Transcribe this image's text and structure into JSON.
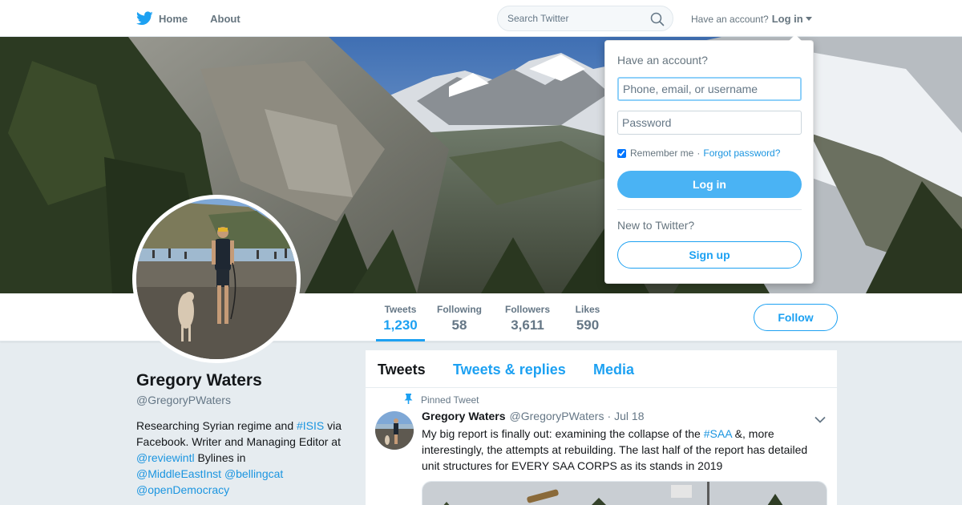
{
  "nav": {
    "home_label": "Home",
    "about_label": "About",
    "search_placeholder": "Search Twitter",
    "have_account": "Have an account?",
    "login_label": "Log in"
  },
  "profile": {
    "name": "Gregory Waters",
    "handle": "@GregoryPWaters",
    "bio_1": "Researching Syrian regime and ",
    "bio_tag_isis": "#ISIS",
    "bio_2": " via Facebook. Writer and Managing Editor at ",
    "bio_mention_reviewintl": "@reviewintl",
    "bio_3": " Bylines in ",
    "bio_mention_mei": "@MiddleEastInst",
    "bio_mention_bellingcat": "@bellingcat",
    "bio_mention_od": "@openDemocracy"
  },
  "stats": [
    {
      "label": "Tweets",
      "value": "1,230"
    },
    {
      "label": "Following",
      "value": "58"
    },
    {
      "label": "Followers",
      "value": "3,611"
    },
    {
      "label": "Likes",
      "value": "590"
    }
  ],
  "follow_label": "Follow",
  "tabs": [
    "Tweets",
    "Tweets & replies",
    "Media"
  ],
  "tweet": {
    "pinned_label": "Pinned Tweet",
    "name": "Gregory Waters",
    "handle": "@GregoryPWaters",
    "date": "Jul 18",
    "text_1": "My big report is finally out: examining the collapse of the ",
    "text_tag": "#SAA",
    "text_2": " &, more interestingly, the attempts at rebuilding. The last half of the report has detailed unit structures for EVERY SAA CORPS as its stands in 2019"
  },
  "login_dropdown": {
    "title": "Have an account?",
    "username_placeholder": "Phone, email, or username",
    "password_placeholder": "Password",
    "remember_label": "Remember me",
    "forgot_label": "Forgot password?",
    "login_button": "Log in",
    "new_label": "New to Twitter?",
    "signup_button": "Sign up"
  },
  "colors": {
    "accent": "#1da1f2",
    "link": "#1b95e0",
    "background": "#e6ecf0"
  }
}
